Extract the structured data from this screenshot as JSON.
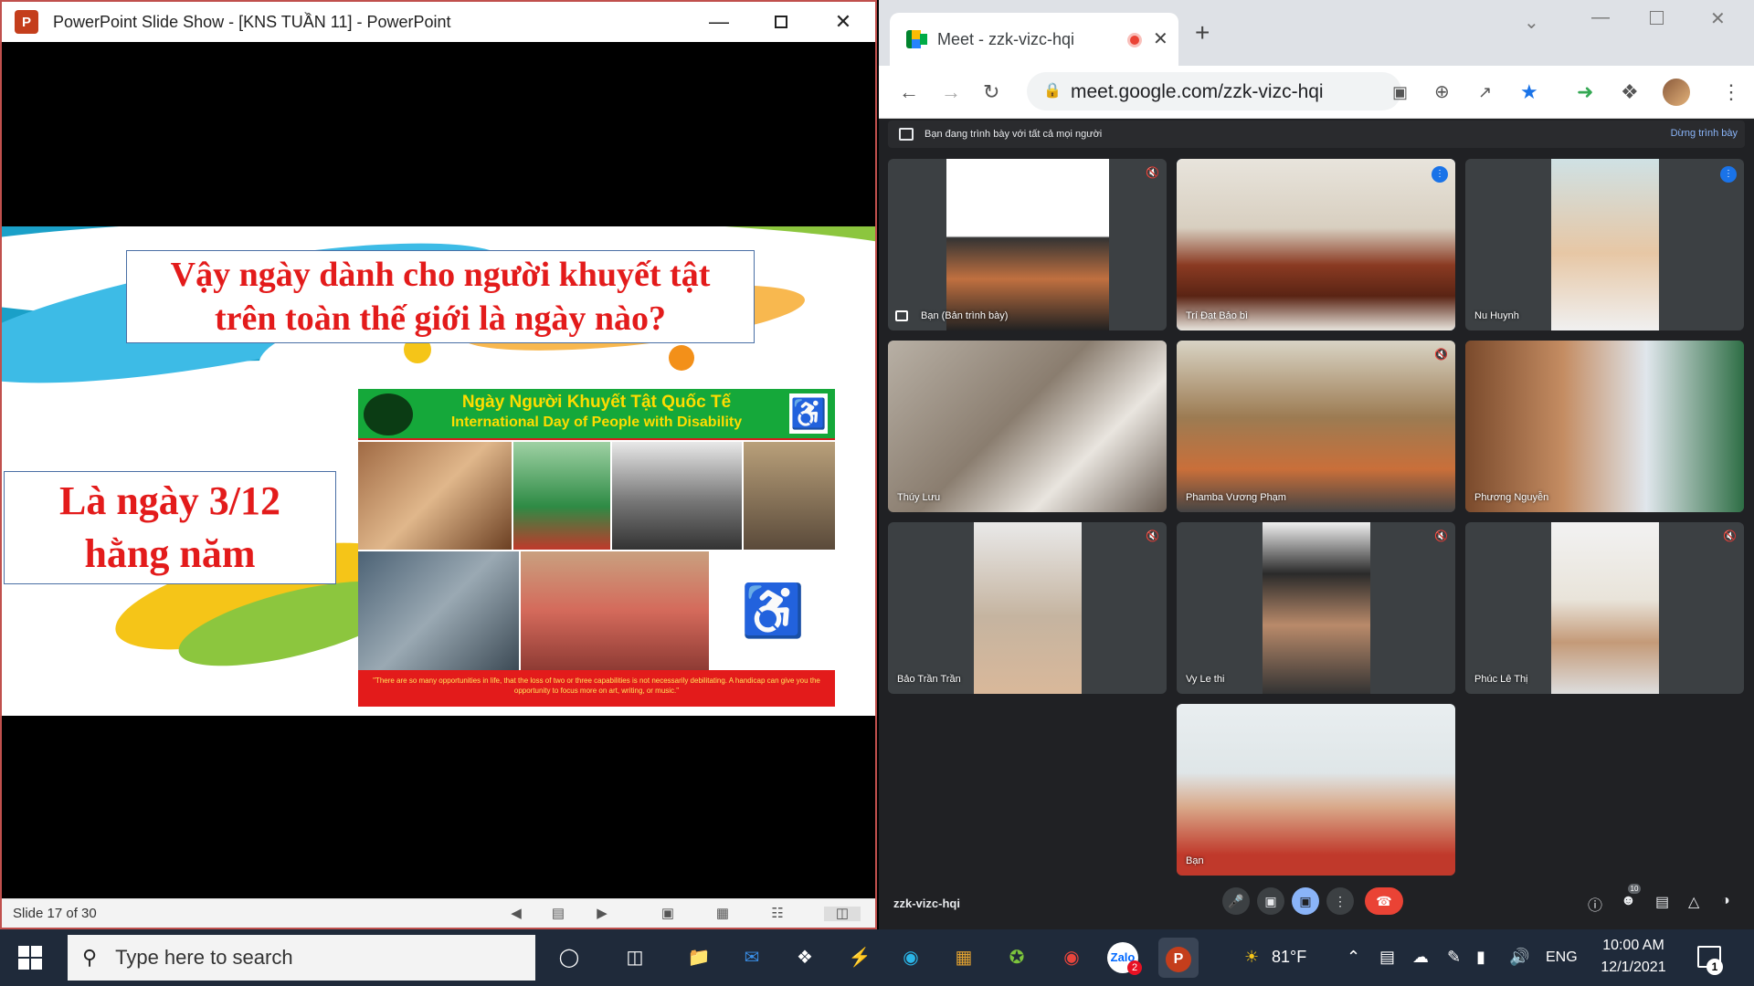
{
  "ppt": {
    "title": "PowerPoint Slide Show - [KNS TUẦN 11] - PowerPoint",
    "logo_letter": "P",
    "slide_status": "Slide 17 of 30",
    "slide": {
      "question": "Vậy ngày dành cho người khuyết tật trên toàn thế giới là ngày nào?",
      "answer": "Là ngày 3/12 hằng năm",
      "poster_title_vi": "Ngày Người Khuyết Tật Quốc Tế",
      "poster_title_en": "International Day of People with Disability",
      "poster_quote": "\"There are so many opportunities in life, that the loss of two or three capabilities is not necessarily debilitating. A handicap can give you the opportunity to focus more on art, writing, or music.\""
    }
  },
  "chrome": {
    "tab_title": "Meet - zzk-vizc-hqi",
    "url": "meet.google.com/zzk-vizc-hqi",
    "presenting_banner": "Bạn đang trình bày với tất cả mọi người",
    "stop_presenting": "Dừng trình bày"
  },
  "meet": {
    "meeting_code": "zzk-vizc-hqi",
    "participant_count": "10",
    "tiles": [
      {
        "name": "Bạn (Bản trình bày)"
      },
      {
        "name": "Trí Đạt Bảo bì"
      },
      {
        "name": "Nu Huynh"
      },
      {
        "name": "Thúy Lưu"
      },
      {
        "name": "Phamba Vương Phạm"
      },
      {
        "name": "Phương Nguyễn"
      },
      {
        "name": "Bảo Trần Trần"
      },
      {
        "name": "Vy Le thi"
      },
      {
        "name": "Phúc Lê Thị"
      },
      {
        "name": "Bạn"
      }
    ]
  },
  "taskbar": {
    "search_placeholder": "Type here to search",
    "weather": "81°F",
    "language": "ENG",
    "time": "10:00 AM",
    "date": "12/1/2021",
    "notification_count": "1",
    "zalo_badge": "2"
  },
  "icons": {
    "close": "close-icon",
    "minimize": "minimize-icon",
    "maximize": "maximize-icon"
  },
  "colors": {
    "slide_text_red": "#e31b1b",
    "meet_bg": "#202124",
    "end_call": "#ea4335",
    "active_tile": "#8ab4f8"
  }
}
